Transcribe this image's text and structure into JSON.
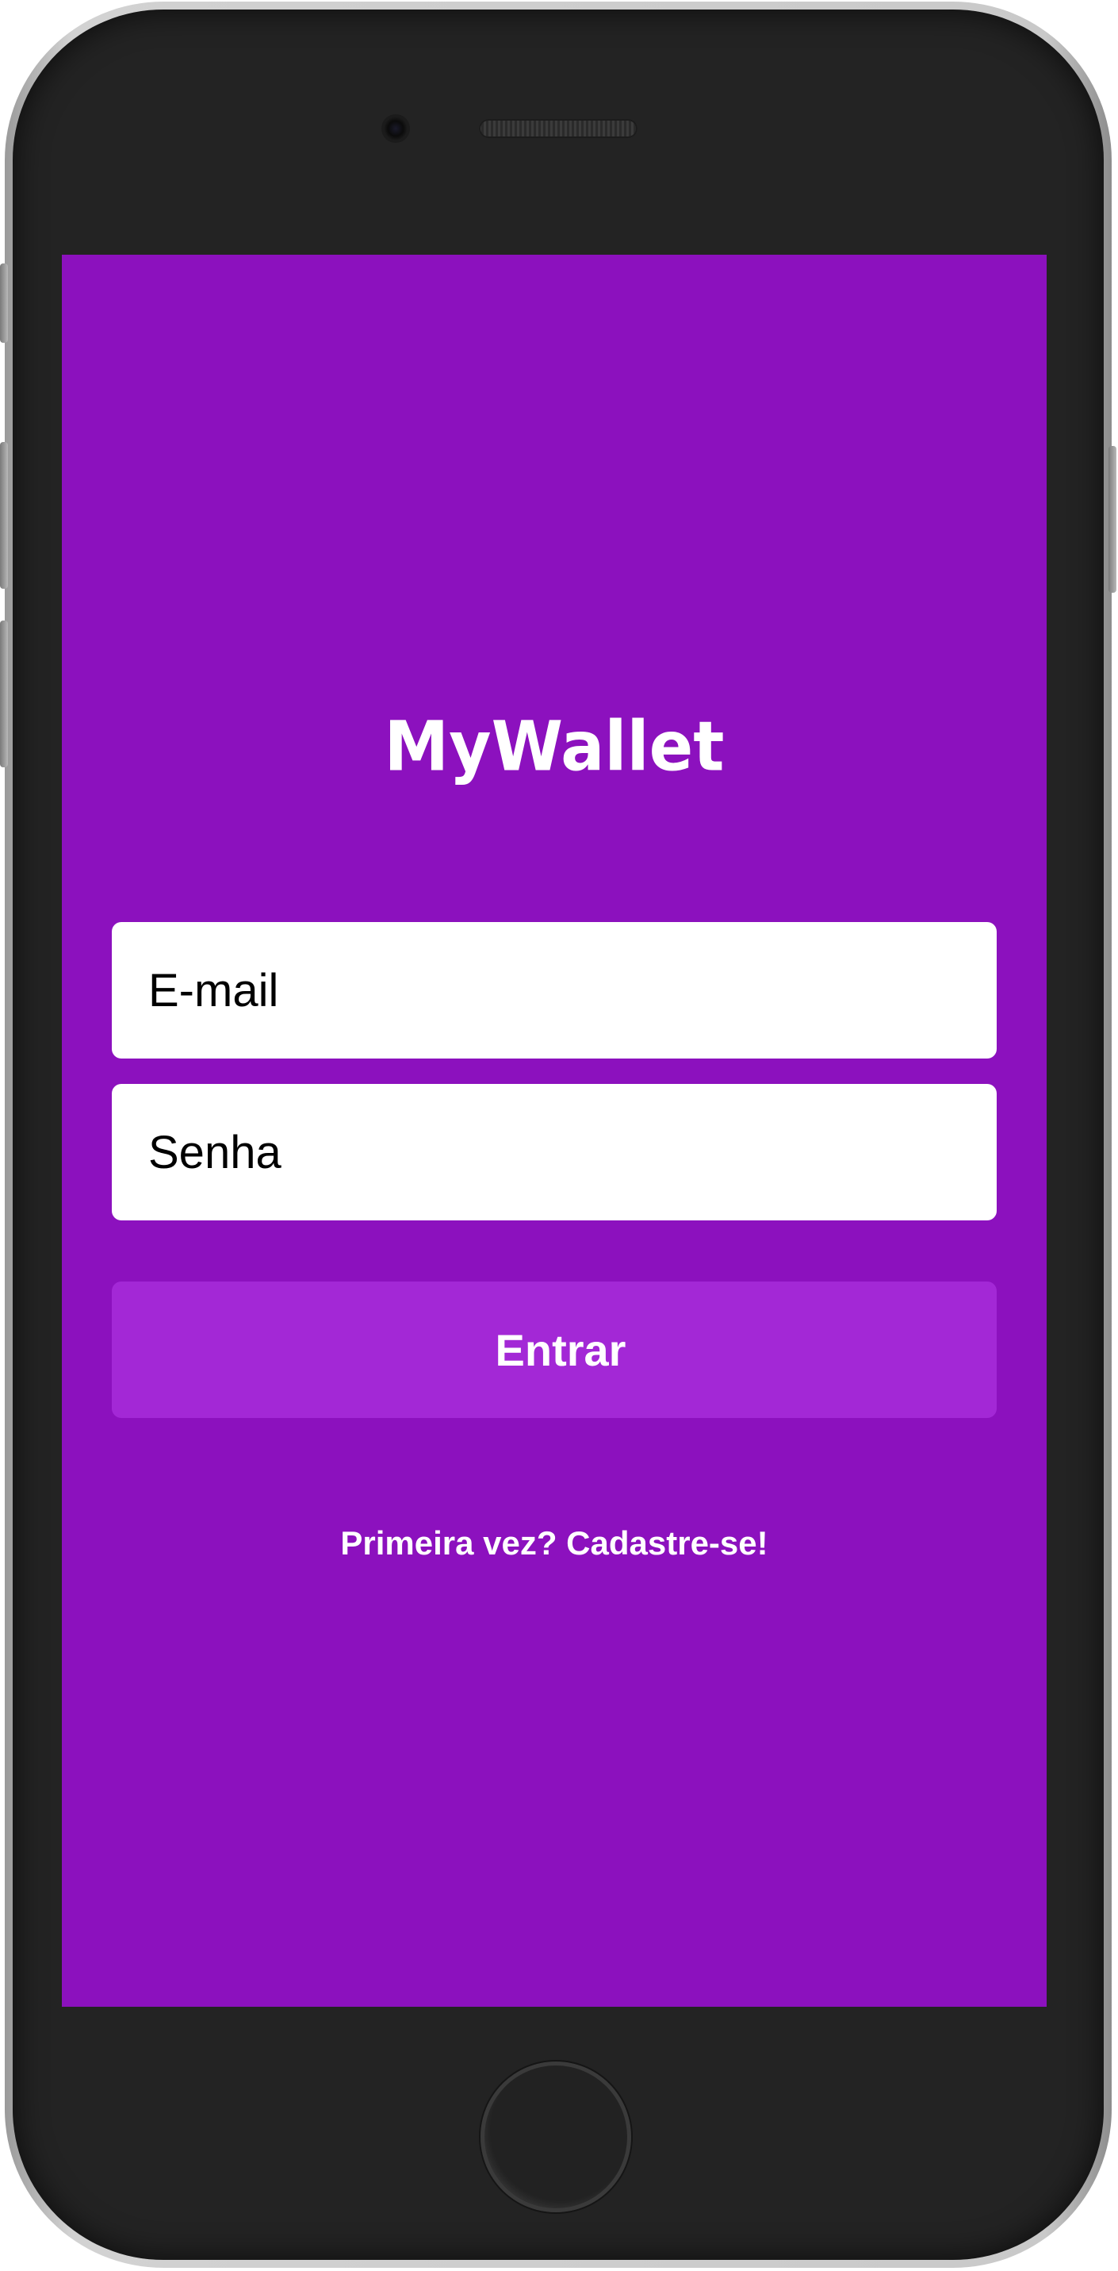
{
  "app": {
    "logo_text": "MyWallet"
  },
  "login_form": {
    "email_placeholder": "E-mail",
    "password_placeholder": "Senha",
    "submit_label": "Entrar",
    "signup_link_label": "Primeira vez? Cadastre-se!"
  },
  "theme": {
    "background_color": "#8c11be",
    "button_color": "#a328d6",
    "input_background": "#ffffff",
    "text_color": "#ffffff"
  },
  "device": {
    "type": "smartphone-frame",
    "icons": [
      "camera-icon",
      "speaker-icon",
      "home-button"
    ]
  }
}
